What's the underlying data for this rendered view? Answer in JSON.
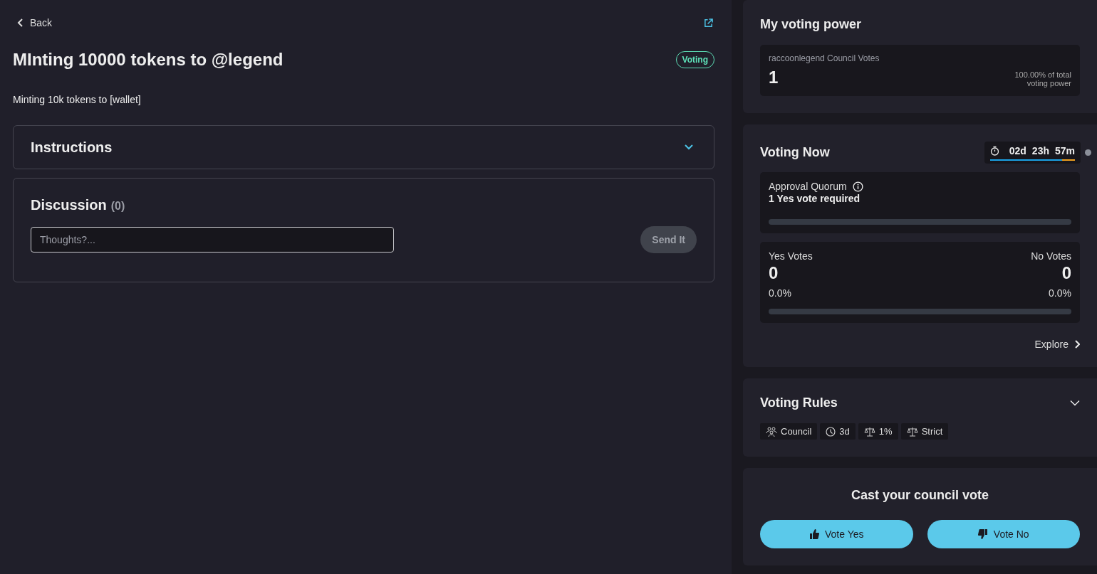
{
  "back": {
    "label": "Back"
  },
  "proposal": {
    "title": "MInting 10000 tokens to @legend",
    "status": "Voting",
    "description": "Minting 10k tokens to [wallet]"
  },
  "instructions": {
    "title": "Instructions",
    "expanded": false
  },
  "discussion": {
    "title": "Discussion",
    "count": "(0)",
    "placeholder": "Thoughts?...",
    "send_button": "Send It"
  },
  "voting_power": {
    "title": "My voting power",
    "label": "raccoonlegend Council Votes",
    "value": "1",
    "share": "100.00% of total voting power"
  },
  "voting_now": {
    "title": "Voting Now",
    "countdown": {
      "days": "02d",
      "hours": "23h",
      "minutes": "57m",
      "level": 0.85
    },
    "quorum": {
      "label": "Approval Quorum",
      "requirement": "1 Yes vote required"
    },
    "yes": {
      "label": "Yes Votes",
      "count": "0",
      "percent": "0.0%"
    },
    "no": {
      "label": "No Votes",
      "count": "0",
      "percent": "0.0%"
    },
    "explore": "Explore"
  },
  "voting_rules": {
    "title": "Voting Rules",
    "expanded": false,
    "chips": [
      {
        "kind": "council",
        "label": "Council"
      },
      {
        "kind": "time",
        "label": "3d"
      },
      {
        "kind": "threshold",
        "label": "1%"
      },
      {
        "kind": "strict",
        "label": "Strict"
      }
    ]
  },
  "cast": {
    "title": "Cast your council vote",
    "buttons": [
      {
        "kind": "yes",
        "label": "Vote Yes"
      },
      {
        "kind": "no",
        "label": "Vote No"
      }
    ]
  }
}
